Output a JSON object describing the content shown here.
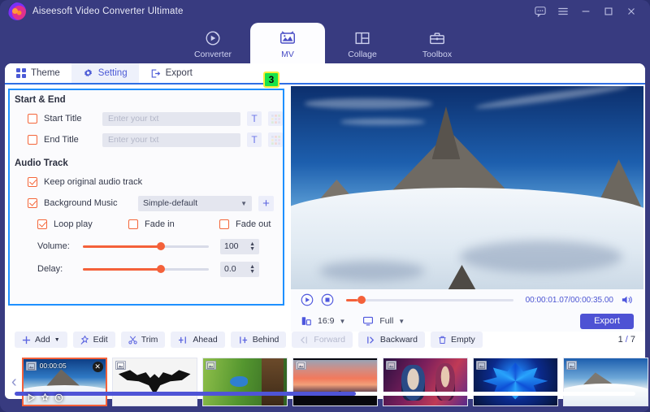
{
  "window": {
    "title": "Aiseesoft Video Converter Ultimate",
    "controls": [
      {
        "name": "feedback-icon",
        "glyph": "feedback"
      },
      {
        "name": "menu-icon",
        "glyph": "menu"
      },
      {
        "name": "minimize-icon",
        "glyph": "minimize"
      },
      {
        "name": "maximize-icon",
        "glyph": "maximize"
      },
      {
        "name": "close-icon",
        "glyph": "close"
      }
    ]
  },
  "main_nav": {
    "active": "MV",
    "items": [
      {
        "label": "Converter",
        "icon": "converter-icon"
      },
      {
        "label": "MV",
        "icon": "mv-icon"
      },
      {
        "label": "Collage",
        "icon": "collage-icon"
      },
      {
        "label": "Toolbox",
        "icon": "toolbox-icon"
      }
    ]
  },
  "sub_tabs": {
    "active": "Setting",
    "items": [
      {
        "label": "Theme",
        "icon": "grid-icon"
      },
      {
        "label": "Setting",
        "icon": "gear-icon"
      },
      {
        "label": "Export",
        "icon": "export-icon"
      }
    ]
  },
  "annotation": {
    "step_badge": "3"
  },
  "settings": {
    "start_end": {
      "section_title": "Start & End",
      "start_title": {
        "label": "Start Title",
        "checked": false,
        "value": "",
        "placeholder": "Enter your txt"
      },
      "end_title": {
        "label": "End Title",
        "checked": false,
        "value": "",
        "placeholder": "Enter your txt"
      },
      "text_button": "T",
      "style_button": "style"
    },
    "audio_track": {
      "section_title": "Audio Track",
      "keep_original": {
        "label": "Keep original audio track",
        "checked": true
      },
      "background_music": {
        "label": "Background Music",
        "checked": true,
        "selected": "Simple-default",
        "add_label": "+"
      },
      "loop_play": {
        "label": "Loop play",
        "checked": true
      },
      "fade_in": {
        "label": "Fade in",
        "checked": false
      },
      "fade_out": {
        "label": "Fade out",
        "checked": false
      },
      "volume": {
        "label": "Volume:",
        "value": "100",
        "percent": 62
      },
      "delay": {
        "label": "Delay:",
        "value": "0.0",
        "percent": 62
      }
    }
  },
  "preview": {
    "transport": {
      "play_icon": "play-icon",
      "stop_icon": "stop-icon",
      "progress_percent": 7,
      "time_current": "00:00:01.07",
      "time_total": "00:00:35.00",
      "time_display": "00:00:01.07/00:00:35.00",
      "volume_icon": "speaker-icon"
    },
    "aspect_ratio": {
      "icon": "aspect-icon",
      "value": "16:9"
    },
    "screen_mode": {
      "icon": "monitor-icon",
      "value": "Full"
    },
    "export_label": "Export"
  },
  "toolbar": {
    "buttons": [
      {
        "label": "Add",
        "icon": "plus-icon",
        "caret": true,
        "disabled": false
      },
      {
        "label": "Edit",
        "icon": "magic-wand-icon",
        "caret": false,
        "disabled": false
      },
      {
        "label": "Trim",
        "icon": "scissors-icon",
        "caret": false,
        "disabled": false
      },
      {
        "label": "Ahead",
        "icon": "insert-ahead-icon",
        "caret": false,
        "disabled": false
      },
      {
        "label": "Behind",
        "icon": "insert-behind-icon",
        "caret": false,
        "disabled": false
      },
      {
        "label": "Forward",
        "icon": "move-forward-icon",
        "caret": false,
        "disabled": true
      },
      {
        "label": "Backward",
        "icon": "move-backward-icon",
        "caret": false,
        "disabled": false
      },
      {
        "label": "Empty",
        "icon": "trash-icon",
        "caret": false,
        "disabled": false
      }
    ],
    "page_current": "1",
    "page_separator": "/",
    "page_total": "7"
  },
  "thumbnails": {
    "prev_arrow": "‹",
    "next_arrow": "›",
    "items": [
      {
        "name": "thumb-mountain",
        "art": "art-mtn",
        "duration": "00:00:05",
        "selected": true,
        "close": "✕"
      },
      {
        "name": "thumb-batman",
        "art": "art-bat",
        "duration": "",
        "selected": false
      },
      {
        "name": "thumb-bird",
        "art": "art-bird",
        "duration": "",
        "selected": false
      },
      {
        "name": "thumb-sunset",
        "art": "art-sunset",
        "duration": "",
        "selected": false
      },
      {
        "name": "thumb-heroes",
        "art": "art-heroes",
        "duration": "",
        "selected": false
      },
      {
        "name": "thumb-neon",
        "art": "art-neon",
        "duration": "",
        "selected": false
      },
      {
        "name": "thumb-snow",
        "art": "art-snow",
        "duration": "",
        "selected": false
      }
    ],
    "scroll_percent": 55
  },
  "colors": {
    "header_bg": "#383b80",
    "accent_blue": "#4e52d4",
    "accent_orange": "#f4613a",
    "highlight_border": "#1e90ff",
    "badge_green": "#19e34a",
    "badge_border": "#fdec3a"
  }
}
